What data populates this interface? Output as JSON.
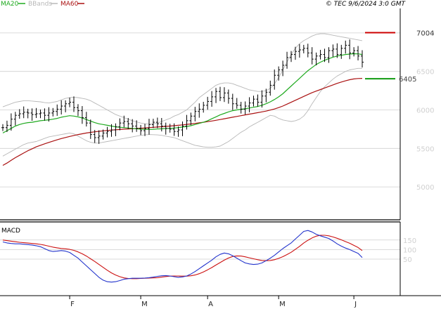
{
  "legend": {
    "ma20_label": "MA20",
    "bbands_label": "BBands",
    "ma60_label": "MA60",
    "ma20_color": "#1faa1f",
    "bbands_color": "#b8b8b8",
    "ma60_color": "#aa1111"
  },
  "credit": "© TEC 9/6/2024 3:0 GMT",
  "price_panel": {
    "resistance_label": "7004",
    "resistance_value": 7004,
    "resistance_color": "#cc0000",
    "support_label": "6405",
    "support_value": 6405,
    "support_color": "#119911"
  },
  "macd_panel": {
    "label": "MACD",
    "macd_color": "#2233cc",
    "signal_color": "#cc1111"
  },
  "chart_data": [
    {
      "type": "line",
      "title": "",
      "price_type": "ohlc-bars",
      "y_ticks": [
        "7000",
        "6500",
        "6000",
        "5500",
        "5000"
      ],
      "y_tick_values": [
        7000,
        6500,
        6000,
        5500,
        5000
      ],
      "ylim": [
        4600,
        7300
      ],
      "x_month_labels": [
        "F",
        "M",
        "A",
        "M",
        "J"
      ],
      "x_month_index": [
        16,
        33,
        49,
        66,
        84
      ],
      "n_sessions": 87,
      "grid": true,
      "price_close": [
        5770,
        5800,
        5880,
        5930,
        5950,
        5970,
        5960,
        5940,
        5950,
        5960,
        5930,
        5960,
        5980,
        6010,
        6050,
        6080,
        6100,
        6030,
        5990,
        5900,
        5830,
        5680,
        5640,
        5660,
        5700,
        5720,
        5740,
        5780,
        5830,
        5850,
        5820,
        5790,
        5760,
        5730,
        5760,
        5810,
        5840,
        5820,
        5790,
        5760,
        5750,
        5720,
        5740,
        5790,
        5860,
        5920,
        5980,
        6010,
        6060,
        6110,
        6170,
        6240,
        6160,
        6220,
        6150,
        6080,
        6060,
        6010,
        6050,
        6090,
        6140,
        6100,
        6180,
        6230,
        6320,
        6450,
        6520,
        6580,
        6680,
        6720,
        6760,
        6780,
        6800,
        6740,
        6660,
        6700,
        6720,
        6680,
        6770,
        6790,
        6720,
        6800,
        6840,
        6740,
        6770,
        6700,
        6620
      ],
      "series": [
        {
          "name": "MA20",
          "values": [
            5700,
            5730,
            5760,
            5790,
            5810,
            5825,
            5835,
            5840,
            5850,
            5860,
            5865,
            5872,
            5880,
            5890,
            5905,
            5915,
            5925,
            5920,
            5910,
            5895,
            5875,
            5855,
            5835,
            5820,
            5810,
            5800,
            5790,
            5780,
            5775,
            5770,
            5765,
            5760,
            5755,
            5750,
            5748,
            5747,
            5748,
            5752,
            5755,
            5758,
            5760,
            5765,
            5770,
            5778,
            5785,
            5795,
            5810,
            5825,
            5840,
            5860,
            5885,
            5910,
            5935,
            5955,
            5975,
            5990,
            6000,
            6008,
            6015,
            6025,
            6035,
            6045,
            6060,
            6080,
            6105,
            6135,
            6170,
            6210,
            6260,
            6310,
            6360,
            6410,
            6460,
            6510,
            6550,
            6590,
            6620,
            6645,
            6665,
            6685,
            6700,
            6710,
            6720,
            6725,
            6730,
            6728,
            6720
          ]
        },
        {
          "name": "MA60",
          "values": [
            5280,
            5310,
            5345,
            5380,
            5410,
            5440,
            5470,
            5495,
            5520,
            5540,
            5560,
            5578,
            5595,
            5612,
            5628,
            5642,
            5655,
            5668,
            5680,
            5690,
            5700,
            5708,
            5716,
            5722,
            5728,
            5733,
            5738,
            5742,
            5746,
            5750,
            5753,
            5756,
            5759,
            5762,
            5766,
            5770,
            5774,
            5778,
            5782,
            5786,
            5790,
            5795,
            5800,
            5806,
            5812,
            5818,
            5825,
            5832,
            5840,
            5848,
            5856,
            5865,
            5875,
            5885,
            5895,
            5905,
            5915,
            5925,
            5935,
            5945,
            5955,
            5965,
            5975,
            5985,
            5998,
            6012,
            6030,
            6050,
            6075,
            6100,
            6125,
            6150,
            6175,
            6200,
            6225,
            6245,
            6265,
            6285,
            6305,
            6325,
            6345,
            6362,
            6378,
            6392,
            6402,
            6408,
            6410
          ]
        },
        {
          "name": "BBands upper",
          "values": [
            6040,
            6060,
            6080,
            6100,
            6110,
            6120,
            6120,
            6115,
            6110,
            6105,
            6095,
            6090,
            6100,
            6110,
            6130,
            6150,
            6160,
            6165,
            6160,
            6150,
            6140,
            6120,
            6090,
            6060,
            6030,
            6000,
            5970,
            5940,
            5920,
            5900,
            5880,
            5860,
            5845,
            5830,
            5820,
            5815,
            5820,
            5830,
            5850,
            5870,
            5890,
            5920,
            5940,
            5970,
            6000,
            6050,
            6100,
            6160,
            6200,
            6240,
            6280,
            6320,
            6340,
            6350,
            6350,
            6340,
            6320,
            6300,
            6280,
            6260,
            6250,
            6240,
            6240,
            6250,
            6280,
            6340,
            6420,
            6520,
            6620,
            6720,
            6800,
            6860,
            6900,
            6930,
            6960,
            6980,
            6990,
            6990,
            6980,
            6970,
            6960,
            6950,
            6940,
            6930,
            6920,
            6910,
            6900
          ]
        },
        {
          "name": "BBands lower",
          "values": [
            5400,
            5430,
            5460,
            5490,
            5520,
            5550,
            5570,
            5580,
            5590,
            5610,
            5630,
            5650,
            5660,
            5670,
            5680,
            5690,
            5700,
            5690,
            5660,
            5630,
            5600,
            5580,
            5570,
            5570,
            5580,
            5590,
            5600,
            5610,
            5620,
            5630,
            5640,
            5650,
            5660,
            5670,
            5675,
            5680,
            5678,
            5675,
            5670,
            5660,
            5650,
            5640,
            5620,
            5600,
            5580,
            5560,
            5540,
            5530,
            5520,
            5515,
            5515,
            5520,
            5530,
            5560,
            5590,
            5630,
            5670,
            5710,
            5740,
            5780,
            5810,
            5840,
            5870,
            5900,
            5930,
            5920,
            5890,
            5870,
            5860,
            5850,
            5860,
            5880,
            5920,
            5990,
            6080,
            6160,
            6240,
            6300,
            6350,
            6400,
            6440,
            6470,
            6500,
            6520,
            6530,
            6540,
            6540
          ]
        }
      ]
    },
    {
      "type": "line",
      "title": "MACD",
      "y_ticks": [
        "150",
        "100",
        "50"
      ],
      "y_tick_values": [
        150,
        100,
        50
      ],
      "ylim": [
        -130,
        230
      ],
      "grid": true,
      "series": [
        {
          "name": "MACD",
          "values": [
            140,
            135,
            132,
            130,
            130,
            128,
            126,
            124,
            120,
            115,
            105,
            95,
            90,
            92,
            95,
            92,
            85,
            70,
            55,
            35,
            15,
            -5,
            -25,
            -45,
            -60,
            -68,
            -70,
            -68,
            -62,
            -55,
            -52,
            -50,
            -50,
            -50,
            -49,
            -47,
            -44,
            -40,
            -37,
            -36,
            -38,
            -42,
            -45,
            -43,
            -38,
            -28,
            -15,
            0,
            15,
            30,
            45,
            62,
            75,
            82,
            78,
            68,
            55,
            42,
            30,
            25,
            22,
            24,
            30,
            42,
            55,
            70,
            88,
            105,
            120,
            135,
            155,
            175,
            195,
            200,
            192,
            180,
            172,
            165,
            158,
            145,
            130,
            118,
            108,
            100,
            90,
            80,
            58
          ]
        },
        {
          "name": "Signal",
          "values": [
            150,
            147,
            144,
            141,
            138,
            136,
            134,
            132,
            130,
            127,
            123,
            118,
            113,
            109,
            106,
            104,
            101,
            96,
            88,
            78,
            66,
            52,
            38,
            22,
            7,
            -8,
            -22,
            -33,
            -42,
            -48,
            -51,
            -52,
            -52,
            -51,
            -50,
            -49,
            -48,
            -47,
            -44,
            -41,
            -39,
            -38,
            -38,
            -39,
            -39,
            -37,
            -33,
            -26,
            -17,
            -6,
            6,
            19,
            32,
            45,
            56,
            64,
            67,
            66,
            62,
            57,
            52,
            47,
            43,
            42,
            43,
            47,
            54,
            63,
            74,
            86,
            101,
            117,
            134,
            149,
            161,
            170,
            175,
            175,
            172,
            166,
            159,
            151,
            142,
            133,
            122,
            111,
            95
          ]
        }
      ]
    }
  ]
}
